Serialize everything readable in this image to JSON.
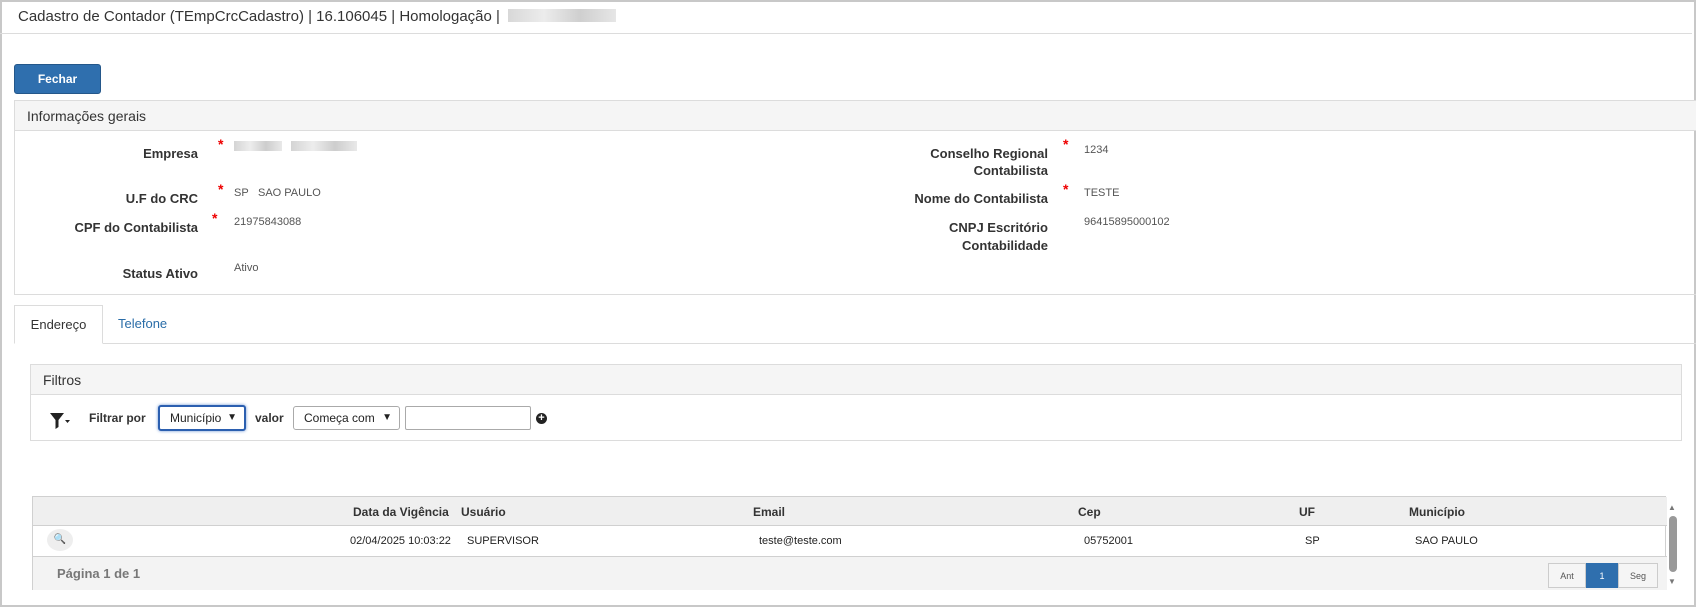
{
  "window": {
    "title": "Cadastro de Contador (TEmpCrcCadastro) | 16.106045 | Homologação |"
  },
  "toolbar": {
    "fechar_label": "Fechar"
  },
  "info_panel": {
    "title": "Informações gerais",
    "fields": {
      "empresa_label": "Empresa",
      "uf_crc_label": "U.F do CRC",
      "uf_crc_code": "SP",
      "uf_crc_name": "SAO PAULO",
      "cpf_label": "CPF do Contabilista",
      "cpf_value": "21975843088",
      "status_label": "Status Ativo",
      "status_value": "Ativo",
      "conselho_label_1": "Conselho Regional",
      "conselho_label_2": "Contabilista",
      "conselho_value": "1234",
      "nome_label": "Nome do Contabilista",
      "nome_value": "TESTE",
      "cnpj_label_1": "CNPJ Escritório",
      "cnpj_label_2": "Contabilidade",
      "cnpj_value": "96415895000102"
    },
    "required_mark": "*"
  },
  "tabs": [
    {
      "label": "Endereço",
      "active": true
    },
    {
      "label": "Telefone",
      "active": false
    }
  ],
  "filters": {
    "title": "Filtros",
    "filter_by_label": "Filtrar por",
    "filter_field_value": "Município",
    "value_label": "valor",
    "operator_value": "Começa com",
    "text_value": "",
    "icons": {
      "filter": "filter-icon",
      "add": "plus-circle-icon",
      "view": "magnifier-icon"
    }
  },
  "grid": {
    "columns": [
      "Data da Vigência",
      "Usuário",
      "Email",
      "Cep",
      "UF",
      "Município"
    ],
    "rows": [
      [
        "02/04/2025 10:03:22",
        "SUPERVISOR",
        "teste@teste.com",
        "05752001",
        "SP",
        "SAO PAULO"
      ]
    ],
    "pagination": {
      "text": "Página 1 de 1",
      "prev": "Ant",
      "current": "1",
      "next": "Seg"
    }
  },
  "colors": {
    "primary": "#2f6fae",
    "required": "#ee0000",
    "link": "#2a6da8"
  }
}
